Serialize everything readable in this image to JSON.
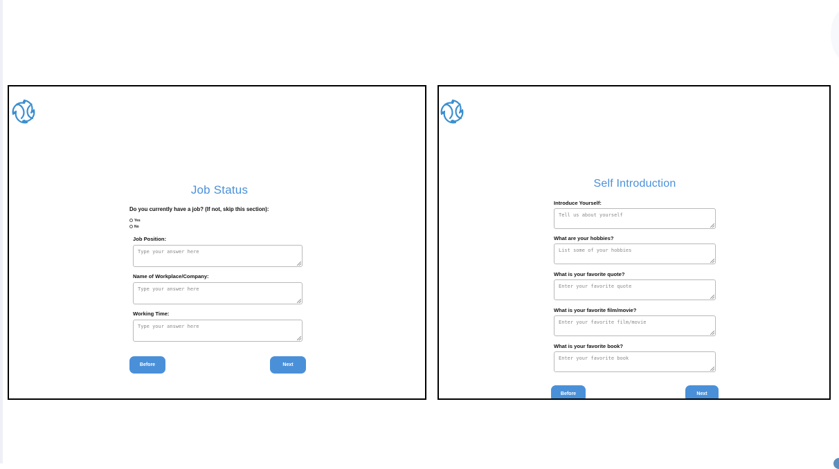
{
  "job_status": {
    "title": "Job Status",
    "question": "Do you currently have a job? (If not, skip this section):",
    "options": [
      "Yes",
      "No"
    ],
    "fields": [
      {
        "label": "Job Position:",
        "placeholder": "Type your answer here"
      },
      {
        "label": "Name of Workplace/Company:",
        "placeholder": "Type your answer here"
      },
      {
        "label": "Working Time:",
        "placeholder": "Type your answer here"
      }
    ],
    "before_label": "Before",
    "next_label": "Next"
  },
  "self_intro": {
    "title": "Self Introduction",
    "fields": [
      {
        "label": "Introduce Yourself:",
        "placeholder": "Tell us about yourself"
      },
      {
        "label": "What are your hobbies?",
        "placeholder": "List some of your hobbies"
      },
      {
        "label": "What is your favorite quote?",
        "placeholder": "Enter your favorite quote"
      },
      {
        "label": "What is your favorite film/movie?",
        "placeholder": "Enter your favorite film/movie"
      },
      {
        "label": "What is your favorite book?",
        "placeholder": "Enter your favorite book"
      }
    ],
    "before_label": "Before",
    "next_label": "Next"
  },
  "colors": {
    "accent": "#4a90d9",
    "logo": "#3a8fd0"
  },
  "icons": {
    "logo": "network-knot-logo-icon"
  }
}
